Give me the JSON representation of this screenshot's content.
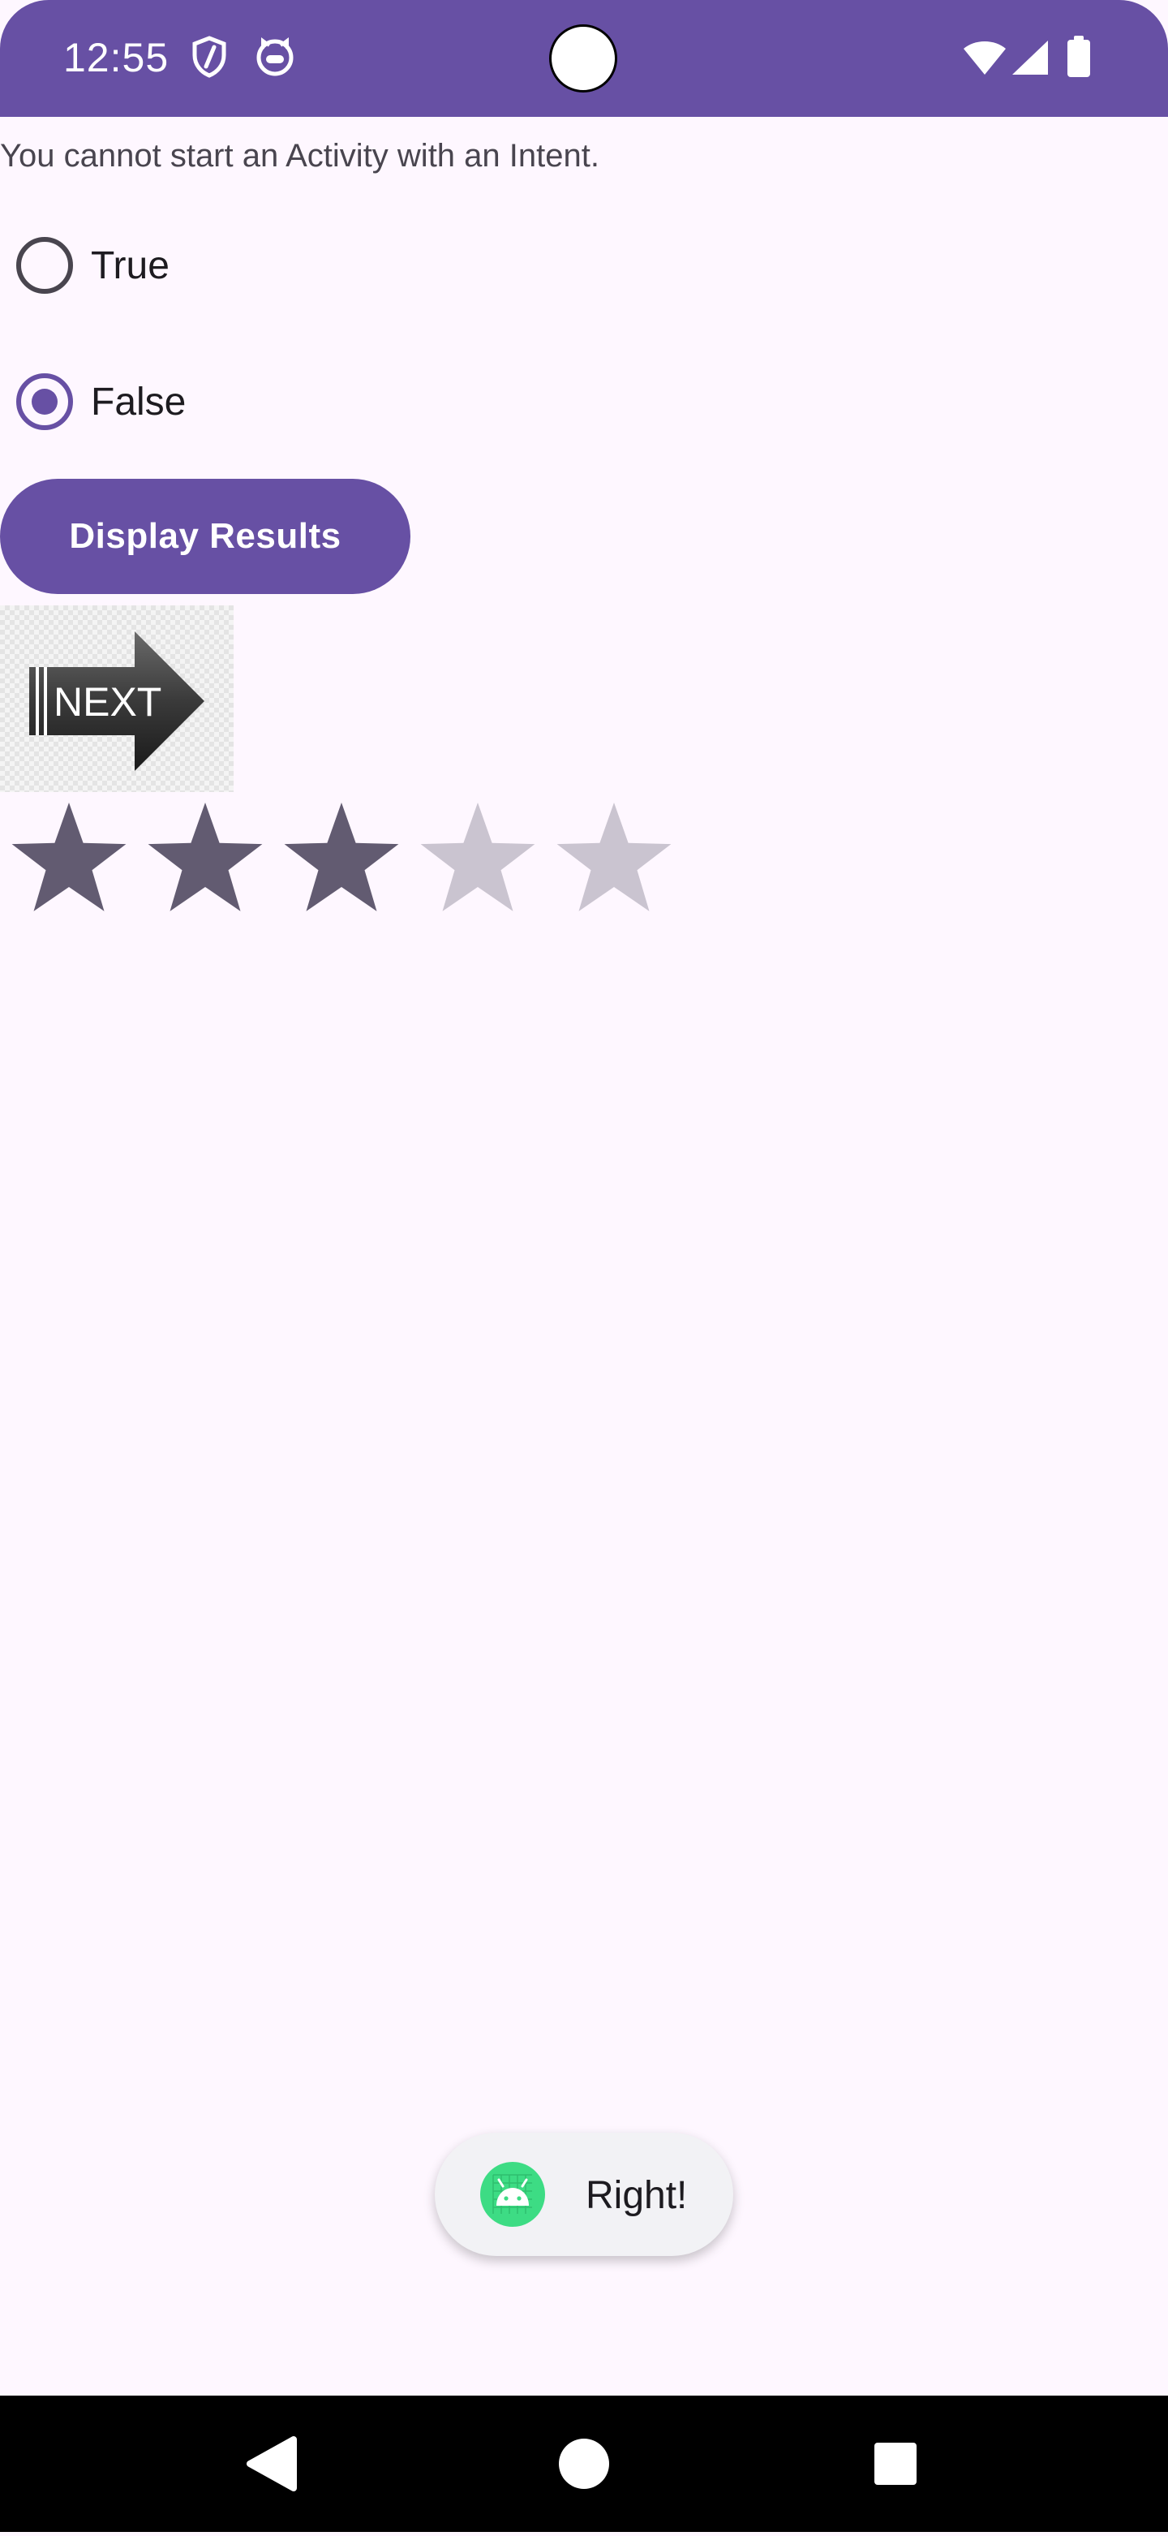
{
  "status_bar": {
    "time": "12:55",
    "icons": [
      "shield-icon",
      "cat-face-icon",
      "wifi-icon",
      "cellular-signal-icon",
      "battery-icon"
    ],
    "color": "#6750a4"
  },
  "question": {
    "text": "You cannot start an Activity with an Intent."
  },
  "options": [
    {
      "label": "True",
      "checked": false
    },
    {
      "label": "False",
      "checked": true
    }
  ],
  "actions": {
    "display_results_label": "Display Results"
  },
  "next_image": {
    "text": "NEXT"
  },
  "rating": {
    "value": 3,
    "max": 5,
    "filled_color": "#625b71",
    "empty_color": "#cac4d0"
  },
  "toast": {
    "text": "Right!",
    "icon": "android-icon"
  },
  "nav_bar": {
    "buttons": [
      "back-icon",
      "home-icon",
      "recents-icon"
    ]
  },
  "colors": {
    "primary": "#6750a4",
    "background": "#fef7ff"
  }
}
